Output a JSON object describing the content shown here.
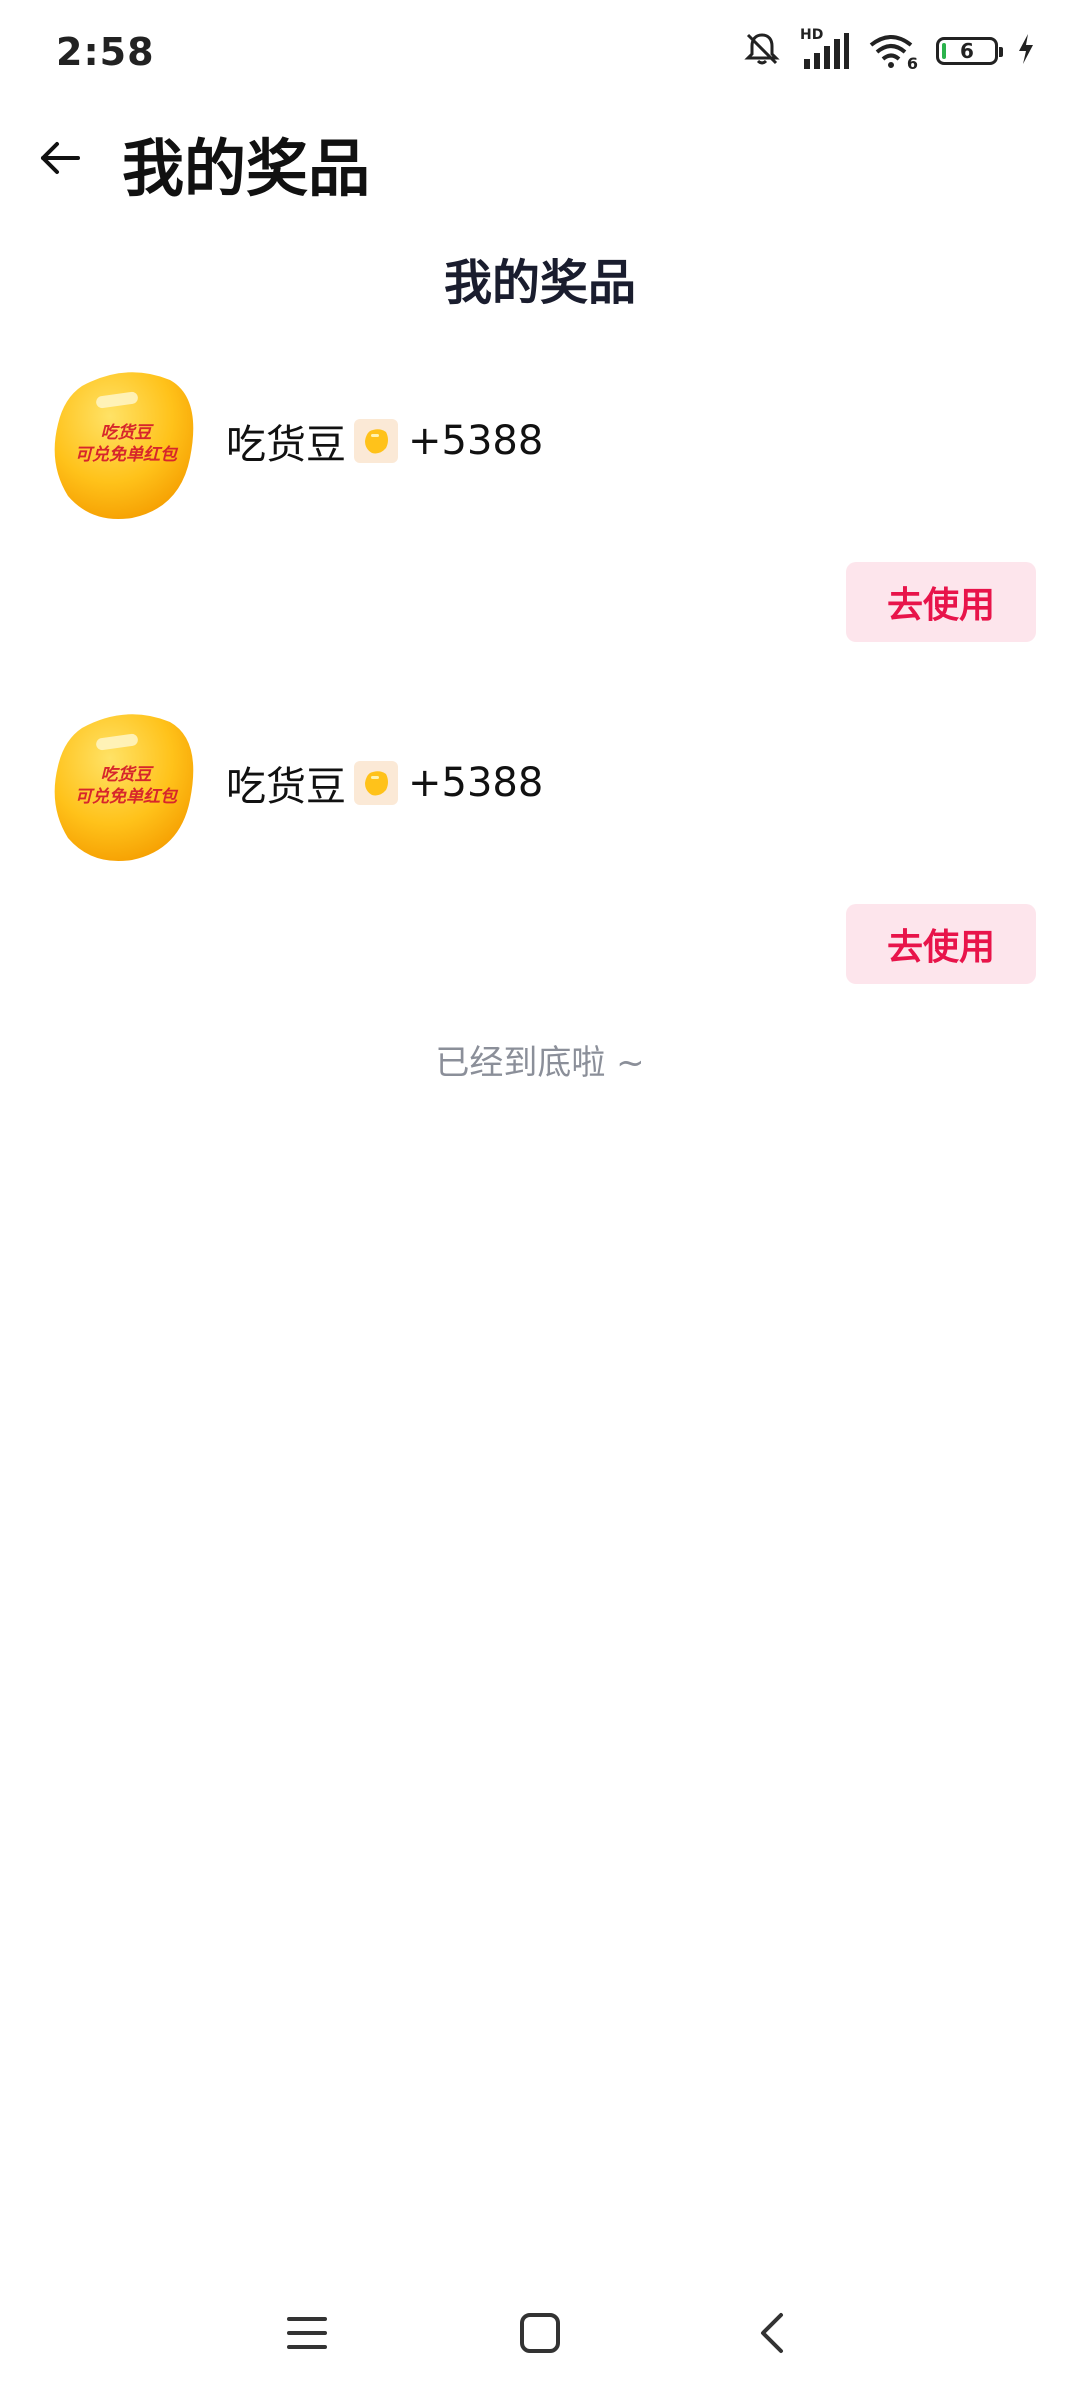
{
  "status_bar": {
    "time": "2:58",
    "signal_label": "HD",
    "wifi_label": "6",
    "battery_level": "6",
    "icons": [
      "bell-off-icon",
      "signal-icon",
      "wifi-icon",
      "battery-icon",
      "charging-icon"
    ]
  },
  "nav": {
    "title": "我的奖品",
    "back_icon": "back-arrow-icon"
  },
  "page": {
    "heading": "我的奖品",
    "end_hint": "已经到底啦 ~"
  },
  "prizes": [
    {
      "thumb_text_line1": "吃货豆",
      "thumb_text_line2": "可兑免单红包",
      "name": "吃货豆",
      "amount": "+5388",
      "button_label": "去使用"
    },
    {
      "thumb_text_line1": "吃货豆",
      "thumb_text_line2": "可兑免单红包",
      "name": "吃货豆",
      "amount": "+5388",
      "button_label": "去使用"
    }
  ],
  "system_nav": {
    "icons": [
      "menu-icon",
      "home-icon",
      "back-icon"
    ]
  },
  "colors": {
    "accent": "#e8144a",
    "button_bg": "#fde5ec",
    "bean_yellow": "#ffc21a"
  }
}
